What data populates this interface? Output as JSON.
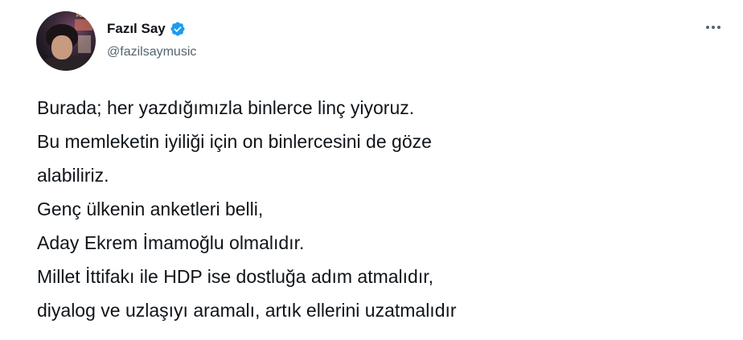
{
  "author": {
    "display_name": "Fazıl Say",
    "handle": "@fazilsaymusic",
    "avatar_caption": "PLAYER",
    "verified": true,
    "verified_color": "#1d9bf0"
  },
  "tweet": {
    "lines": [
      "Burada; her yazdığımızla binlerce linç yiyoruz.",
      "Bu memleketin iyiliği için on binlercesini de göze",
      "alabiliriz.",
      "Genç ülkenin anketleri belli,",
      "Aday Ekrem İmamoğlu olmalıdır.",
      "Millet İttifakı ile HDP ise dostluğa adım atmalıdır,",
      "diyalog ve uzlaşıyı aramalı, artık ellerini uzatmalıdır"
    ]
  },
  "icons": {
    "more": "more-options-icon",
    "verified": "verified-badge-icon"
  }
}
